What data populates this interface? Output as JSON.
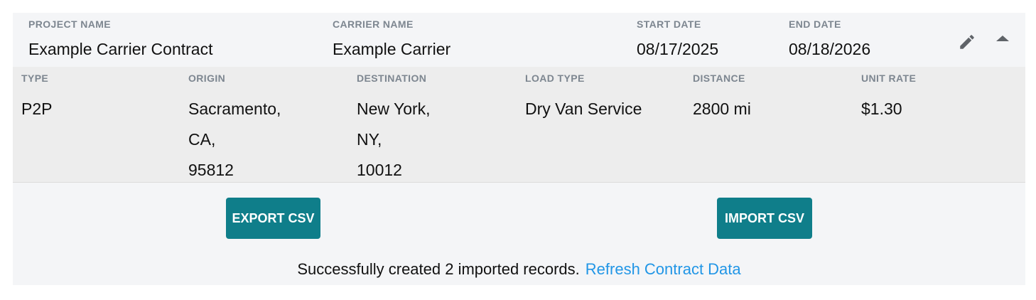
{
  "header": {
    "project_name_label": "PROJECT NAME",
    "project_name": "Example Carrier Contract",
    "carrier_name_label": "CARRIER NAME",
    "carrier_name": "Example Carrier",
    "start_date_label": "START DATE",
    "start_date": "08/17/2025",
    "end_date_label": "END DATE",
    "end_date": "08/18/2026",
    "edit_icon": "pencil-icon",
    "collapse_icon": "caret-up-icon"
  },
  "details": {
    "type_label": "TYPE",
    "type": "P2P",
    "origin_label": "ORIGIN",
    "origin": {
      "line1": "Sacramento,",
      "line2": "CA,",
      "line3": "95812"
    },
    "destination_label": "DESTINATION",
    "destination": {
      "line1": "New York,",
      "line2": "NY,",
      "line3": "10012"
    },
    "load_type_label": "LOAD TYPE",
    "load_type": "Dry Van Service",
    "distance_label": "DISTANCE",
    "distance": "2800 mi",
    "unit_rate_label": "UNIT RATE",
    "unit_rate": "$1.30"
  },
  "actions": {
    "export_label": "EXPORT CSV",
    "import_label": "IMPORT CSV"
  },
  "status": {
    "message": "Successfully created 2 imported records.",
    "refresh_link": "Refresh Contract Data"
  },
  "colors": {
    "button": "#0f7e8a",
    "link": "#2196e6",
    "card_bg": "#f4f5f7",
    "details_bg": "#ededed"
  }
}
